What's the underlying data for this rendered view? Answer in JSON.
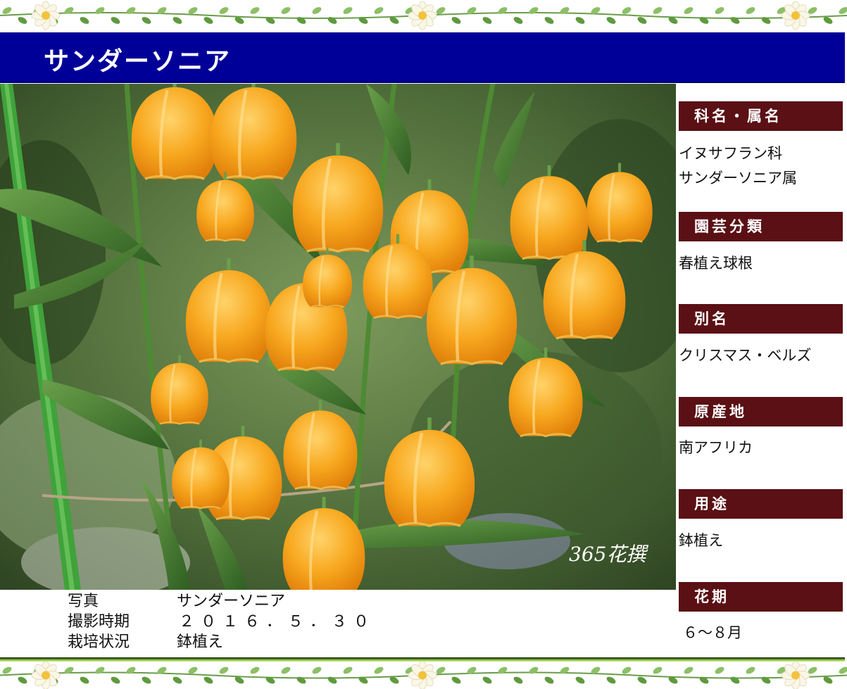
{
  "title": "サンダーソニア",
  "photo": {
    "watermark": "365花撰"
  },
  "caption": [
    {
      "label": "写真",
      "value": "サンダーソニア"
    },
    {
      "label": "撮影時期",
      "value": "２０１６．５．３０"
    },
    {
      "label": "栽培状況",
      "value": "鉢植え"
    }
  ],
  "info": {
    "family": {
      "header": "科名・属名",
      "lines": [
        "イヌサフラン科",
        "サンダーソニア属"
      ]
    },
    "category": {
      "header": "園芸分類",
      "value": "春植え球根"
    },
    "alias": {
      "header": "別名",
      "value": "クリスマス・ベルズ"
    },
    "origin": {
      "header": "原産地",
      "value": "南アフリカ"
    },
    "usage": {
      "header": "用途",
      "value": "鉢植え"
    },
    "season": {
      "header": "花期",
      "value": "６～８月"
    }
  },
  "colors": {
    "title_bar": "#000099",
    "info_header": "#5a1014",
    "flower": "#f7a21b",
    "leaf": "#3f7a2c"
  },
  "icons": {
    "border_flower": "white-daisy",
    "border_vine": "leaf-vine"
  }
}
